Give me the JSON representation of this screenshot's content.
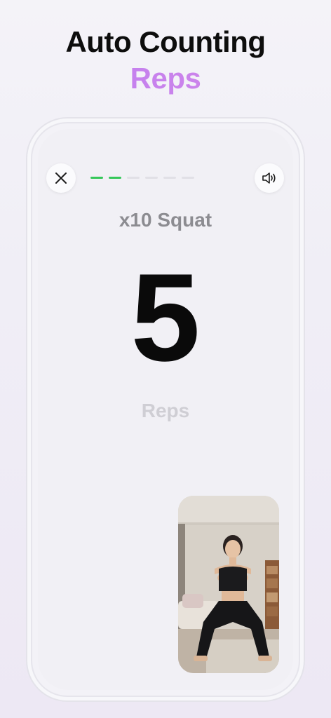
{
  "header": {
    "title": "Auto Counting",
    "accent": "Reps"
  },
  "workout": {
    "exercise": "x10 Squat",
    "count": "5",
    "unit": "Reps",
    "progress": {
      "completed": 2,
      "total": 6
    }
  },
  "colors": {
    "progress_done": "#35c759",
    "progress_todo": "#e1e0e6",
    "accent_start": "#b97cf3",
    "accent_end": "#d889e6"
  },
  "icons": {
    "close": "close-icon",
    "sound": "speaker-icon"
  }
}
